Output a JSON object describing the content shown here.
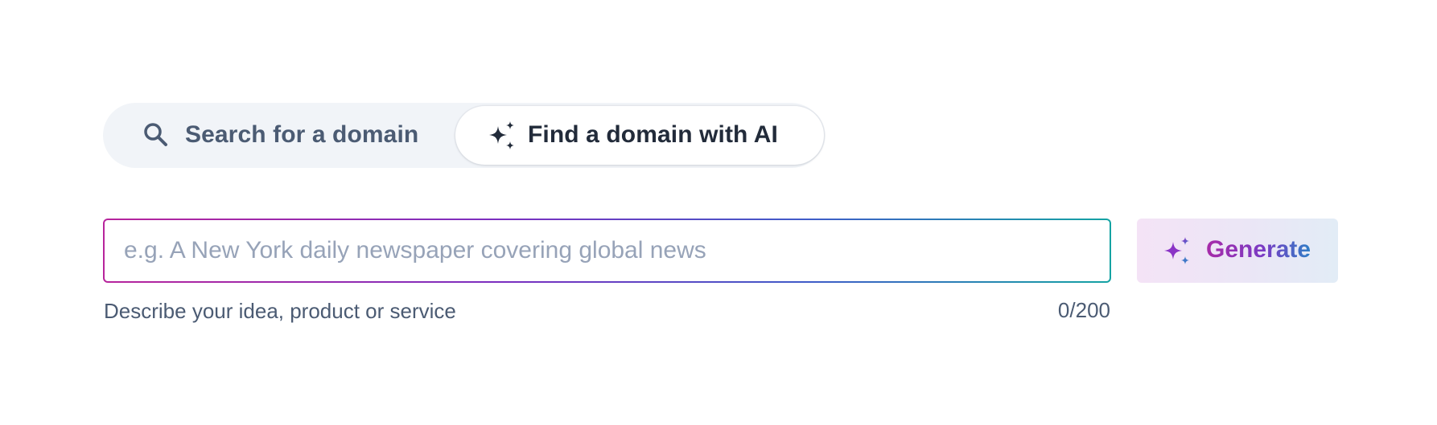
{
  "tabs": [
    {
      "label": "Search for a domain",
      "icon": "search-icon",
      "active": false
    },
    {
      "label": "Find a domain with AI",
      "icon": "sparkles-icon",
      "active": true
    }
  ],
  "ai_input": {
    "value": "",
    "placeholder": "e.g. A New York daily newspaper covering global news",
    "helper_text": "Describe your idea, product or service",
    "char_count": "0/200"
  },
  "generate_button": {
    "label": "Generate",
    "icon": "sparkles-icon"
  },
  "colors": {
    "tab_bg": "#f1f4f8",
    "text_primary": "#222b3a",
    "text_secondary": "#4b5b73",
    "placeholder": "#97a3b8",
    "gradient_start": "#b7249c",
    "gradient_mid": "#7a2fc0",
    "gradient_end": "#14a3a3"
  }
}
